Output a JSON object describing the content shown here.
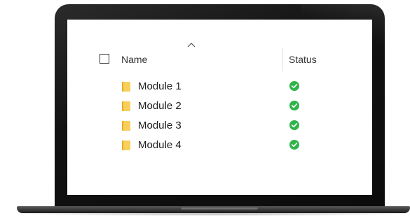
{
  "header": {
    "name_label": "Name",
    "status_label": "Status"
  },
  "files": [
    {
      "name": "Module 1",
      "status": "complete"
    },
    {
      "name": "Module 2",
      "status": "complete"
    },
    {
      "name": "Module 3",
      "status": "complete"
    },
    {
      "name": "Module 4",
      "status": "complete"
    }
  ],
  "colors": {
    "folder": "#f3c24e",
    "status_ok": "#2fb44a"
  },
  "icons": {
    "folder": "folder-icon",
    "status": "check-circle-icon",
    "sort": "chevron-up-icon"
  }
}
